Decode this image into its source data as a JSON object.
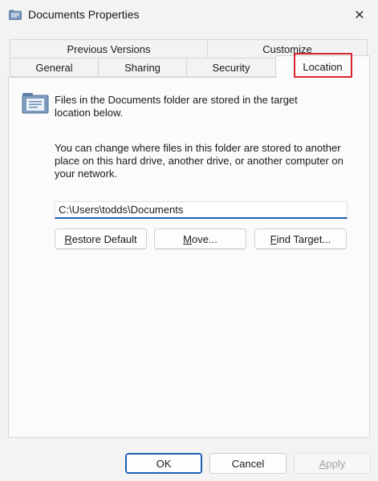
{
  "window": {
    "title": "Documents Properties",
    "close_glyph": "✕"
  },
  "tabs": {
    "row1": [
      {
        "label": "Previous Versions"
      },
      {
        "label": "Customize"
      }
    ],
    "row2": [
      {
        "label": "General"
      },
      {
        "label": "Sharing"
      },
      {
        "label": "Security"
      },
      {
        "label": "Location",
        "active": true
      }
    ]
  },
  "location": {
    "description1": "Files in the Documents folder are stored in the target location below.",
    "description2": "You can change where files in this folder are stored to another place on this hard drive, another drive, or another computer on your network.",
    "path_value": "C:\\Users\\todds\\Documents",
    "restore_default": {
      "mnemonic": "R",
      "rest": "estore Default"
    },
    "move": {
      "mnemonic": "M",
      "rest": "ove..."
    },
    "find_target": {
      "mnemonic": "F",
      "rest": "ind Target..."
    }
  },
  "footer": {
    "ok": "OK",
    "cancel": "Cancel",
    "apply": {
      "mnemonic": "A",
      "rest": "pply"
    }
  },
  "colors": {
    "highlight": "#d8252d",
    "accent": "#1f5fb0"
  },
  "icons": {
    "title": "folder-documents-icon",
    "panel": "folder-documents-icon",
    "close": "close-icon"
  }
}
